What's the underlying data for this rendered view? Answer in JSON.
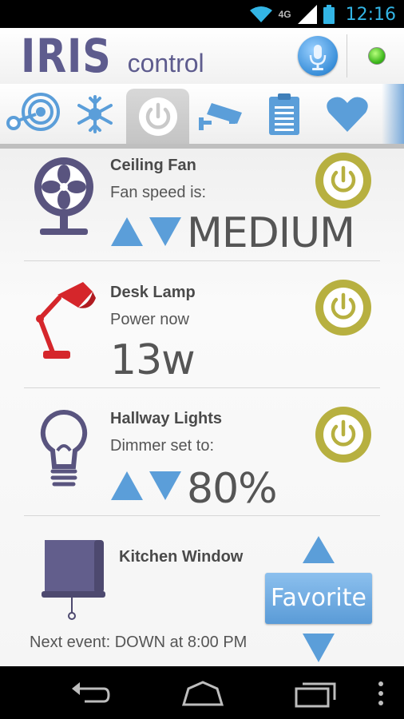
{
  "status_bar": {
    "time": "12:16",
    "network": "4G",
    "icons": [
      "wifi-icon",
      "signal-icon",
      "battery-icon"
    ]
  },
  "header": {
    "brand_name": "IRIS",
    "brand_suffix": "control",
    "mic_icon": "microphone-icon",
    "status_indicator_color": "#3ab51a"
  },
  "tabs": [
    {
      "name": "tab-network",
      "icon": "network-icon",
      "active": false
    },
    {
      "name": "tab-climate",
      "icon": "snowflake-sun-icon",
      "active": false
    },
    {
      "name": "tab-power",
      "icon": "power-icon",
      "active": true
    },
    {
      "name": "tab-camera",
      "icon": "camera-icon",
      "active": false
    },
    {
      "name": "tab-clipboard",
      "icon": "clipboard-icon",
      "active": false
    },
    {
      "name": "tab-favorites",
      "icon": "heart-icon",
      "active": false
    }
  ],
  "devices": {
    "ceiling_fan": {
      "name": "Ceiling Fan",
      "label": "Fan speed is:",
      "value": "MEDIUM"
    },
    "desk_lamp": {
      "name": "Desk Lamp",
      "label": "Power now",
      "value": "13w"
    },
    "hallway_lights": {
      "name": "Hallway Lights",
      "label": "Dimmer set to:",
      "value": "80%"
    },
    "kitchen_window": {
      "name": "Kitchen Window",
      "favorite_label": "Favorite",
      "next_event": "Next event: DOWN at 8:00 PM"
    }
  },
  "colors": {
    "accent_blue": "#5a9bd7",
    "power_button": "#b7b040",
    "brand": "#5e5c8e",
    "lamp": "#d5262b"
  }
}
